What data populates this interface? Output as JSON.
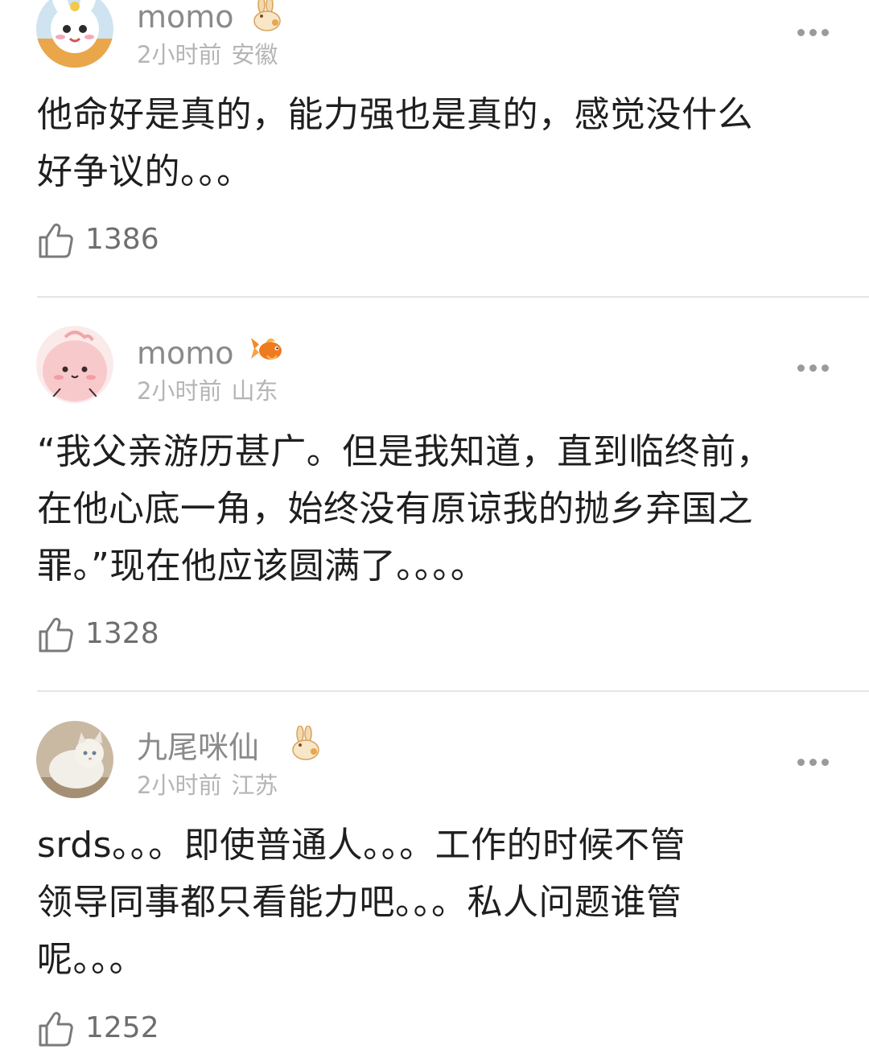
{
  "comments": [
    {
      "username": "momo",
      "badge_icon": "rabbit-badge-icon",
      "time": "2小时前",
      "location": "安徽",
      "lines": [
        "他命好是真的，能力强也是真的，感觉没什么",
        "好争议的。。。"
      ],
      "likes": "1386"
    },
    {
      "username": "momo",
      "badge_icon": "goldfish-badge-icon",
      "time": "2小时前",
      "location": "山东",
      "lines": [
        "“我父亲游历甚广。但是我知道，直到临终前，",
        "在他心底一角，始终没有原谅我的抛乡弃国之",
        "罪。”现在他应该圆满了。。。。"
      ],
      "likes": "1328"
    },
    {
      "username": "九尾咪仙",
      "badge_icon": "rabbit-badge-icon",
      "time": "2小时前",
      "location": "江苏",
      "lines": [
        "srds。。。即使普通人。。。工作的时候不管",
        "领导同事都只看能力吧。。。私人问题谁管",
        "呢。。。"
      ],
      "likes": "1252"
    }
  ],
  "colors": {
    "username": "#8a8a8a",
    "meta": "#b5b5b5",
    "content": "#1f1f1f",
    "like_count": "#6e6e6e",
    "divider": "#e4e4e4"
  }
}
